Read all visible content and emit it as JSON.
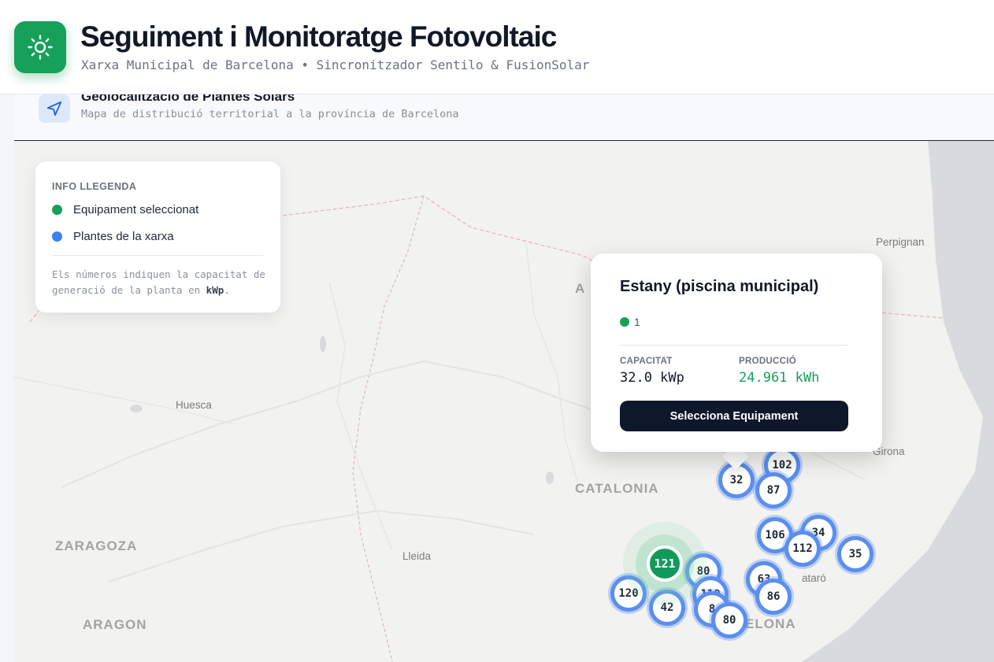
{
  "header": {
    "title": "Seguiment i Monitoratge Fotovoltaic",
    "subtitle": "Xarxa Municipal de Barcelona • Sincronitzador Sentilo & FusionSolar",
    "logo_icon": "sun-icon",
    "accent": "#16a05a"
  },
  "panel": {
    "title": "Geolocalització de Plantes Solars",
    "subtitle": "Mapa de distribució territorial a la província de Barcelona",
    "icon": "navigation-arrow-icon"
  },
  "legend": {
    "heading": "INFO LLEGENDA",
    "items": [
      {
        "label": "Equipament seleccionat",
        "color": "#16a05a"
      },
      {
        "label": "Plantes de la xarxa",
        "color": "#3b82f6"
      }
    ],
    "note_prefix": "Els números indiquen la capacitat de generació de la planta en ",
    "note_unit": "kWp",
    "note_suffix": "."
  },
  "map_labels": {
    "perpignan": "Perpignan",
    "huesca": "Huesca",
    "catalonia": "CATALONIA",
    "zaragoza": "ZARAGOZA",
    "lleida": "Lleida",
    "aragon": "ARAGON",
    "girona": "Girona",
    "mataro": "ataró",
    "barcelona": "ELONA",
    "andorra": "A"
  },
  "markers": {
    "m102": "102",
    "m32": "32",
    "m87": "87",
    "m106": "106",
    "m34": "34",
    "m112": "112",
    "m35": "35",
    "m121": "121",
    "m80a": "80",
    "m120": "120",
    "m42": "42",
    "m110": "110",
    "m8x": "8",
    "m80b": "80",
    "m63": "63",
    "m86": "86"
  },
  "popup": {
    "title": "Estany (piscina municipal)",
    "status_count": "1",
    "capacity_label": "CAPACITAT",
    "capacity_value": "32.0 kWp",
    "production_label": "PRODUCCIÓ",
    "production_value": "24.961 kWh",
    "production_color": "#16a05a",
    "button_label": "Selecciona Equipament"
  }
}
